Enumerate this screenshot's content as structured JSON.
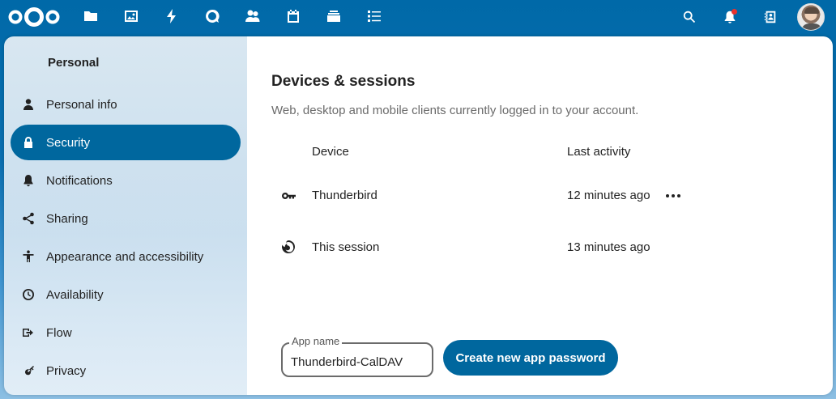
{
  "header": {
    "app_icons": [
      "files-icon",
      "photos-icon",
      "activity-icon",
      "talk-icon",
      "contacts-icon",
      "calendar-icon",
      "deck-icon",
      "tasks-icon"
    ],
    "right_icons": [
      "search-icon",
      "notifications-icon",
      "contacts-menu-icon"
    ],
    "notification_dot_color": "#e9322d"
  },
  "sidebar": {
    "caption": "Personal",
    "items": [
      {
        "label": "Personal info",
        "icon": "person-icon"
      },
      {
        "label": "Security",
        "icon": "lock-icon",
        "active": true
      },
      {
        "label": "Notifications",
        "icon": "bell-icon"
      },
      {
        "label": "Sharing",
        "icon": "share-icon"
      },
      {
        "label": "Appearance and accessibility",
        "icon": "accessibility-icon"
      },
      {
        "label": "Availability",
        "icon": "clock-icon"
      },
      {
        "label": "Flow",
        "icon": "flow-icon"
      },
      {
        "label": "Privacy",
        "icon": "key-icon"
      }
    ]
  },
  "main": {
    "title": "Devices & sessions",
    "description": "Web, desktop and mobile clients currently logged in to your account.",
    "columns": {
      "device": "Device",
      "last_activity": "Last activity"
    },
    "sessions": [
      {
        "device": "Thunderbird",
        "last_activity": "12 minutes ago",
        "icon": "key-icon"
      },
      {
        "device": "This session",
        "last_activity": "13 minutes ago",
        "icon": "firefox-icon"
      }
    ],
    "app_name_label": "App name",
    "app_name_value": "Thunderbird-CalDAV",
    "create_button": "Create new app password"
  },
  "colors": {
    "primary": "#00679e",
    "header_bg": "#0069a8"
  }
}
